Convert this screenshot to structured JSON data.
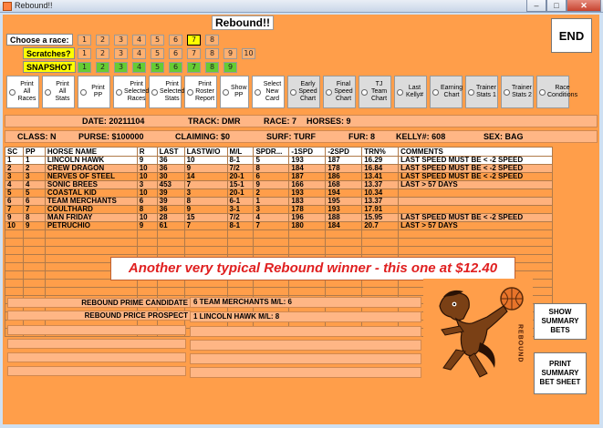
{
  "window": {
    "title": "Rebound!!",
    "min": "–",
    "max": "□",
    "close": "✕"
  },
  "app": {
    "title": "Rebound!!",
    "end_label": "END"
  },
  "race_selector": {
    "choose_label": "Choose a race:",
    "scratches_label": "Scratches?",
    "snapshot_label": "SNAPSHOT",
    "race_numbers": [
      "1",
      "2",
      "3",
      "4",
      "5",
      "6",
      "7",
      "8"
    ],
    "selected_race": "7",
    "scratch_numbers": [
      "1",
      "2",
      "3",
      "4",
      "5",
      "6",
      "7",
      "8",
      "9",
      "10"
    ],
    "snapshot_numbers": [
      "1",
      "2",
      "3",
      "4",
      "5",
      "6",
      "7",
      "8",
      "9"
    ]
  },
  "options": [
    {
      "label": "Print All Races",
      "style": "white"
    },
    {
      "label": "Print All Stats",
      "style": "white"
    },
    {
      "label": "Print PP",
      "style": "white"
    },
    {
      "label": "Print Selected Races",
      "style": "white"
    },
    {
      "label": "Print Selected Stats",
      "style": "white"
    },
    {
      "label": "Print Roster Report",
      "style": "white"
    },
    {
      "label": "Show PP",
      "style": "white"
    },
    {
      "label": "Select New Card",
      "style": "white"
    },
    {
      "label": "Early Speed Chart",
      "style": "gray"
    },
    {
      "label": "Final Speed Chart",
      "style": "gray"
    },
    {
      "label": "TJ Team Chart",
      "style": "gray"
    },
    {
      "label": "Last Kelly#",
      "style": "gray"
    },
    {
      "label": "Earning Chart",
      "style": "gray"
    },
    {
      "label": "Trainer Stats 1",
      "style": "gray"
    },
    {
      "label": "Trainer Stats 2",
      "style": "gray"
    },
    {
      "label": "Race Conditions",
      "style": "gray"
    }
  ],
  "race_info": {
    "date": "DATE: 20211104",
    "track": "TRACK: DMR",
    "race": "RACE: 7",
    "horses": "HORSES: 9",
    "class": "CLASS: N",
    "purse": "PURSE: $100000",
    "claiming": "CLAIMING: $0",
    "surf": "SURF: TURF",
    "fur": "FUR: 8",
    "kelly": "KELLY#: 608",
    "sex": "SEX: BAG"
  },
  "table": {
    "headers": [
      "SC",
      "PP",
      "HORSE NAME",
      "R",
      "LAST",
      "LASTW/O",
      "M/L",
      "SPDR...",
      "-1SPD",
      "-2SPD",
      "TRN%",
      "COMMENTS"
    ],
    "rows": [
      [
        "1",
        "1",
        "LINCOLN HAWK",
        "9",
        "36",
        "10",
        "8-1",
        "5",
        "193",
        "187",
        "16.29",
        "LAST SPEED MUST BE < -2 SPEED"
      ],
      [
        "2",
        "2",
        "CREW DRAGON",
        "10",
        "36",
        "9",
        "7/2",
        "8",
        "184",
        "178",
        "16.84",
        "LAST SPEED MUST BE < -2 SPEED"
      ],
      [
        "3",
        "3",
        "NERVES OF STEEL",
        "10",
        "30",
        "14",
        "20-1",
        "6",
        "187",
        "186",
        "13.41",
        "LAST SPEED MUST BE < -2 SPEED"
      ],
      [
        "4",
        "4",
        "SONIC BREES",
        "3",
        "453",
        "7",
        "15-1",
        "9",
        "166",
        "168",
        "13.37",
        "LAST > 57 DAYS"
      ],
      [
        "5",
        "5",
        "COASTAL KID",
        "10",
        "39",
        "3",
        "20-1",
        "2",
        "193",
        "194",
        "10.34",
        ""
      ],
      [
        "6",
        "6",
        "TEAM MERCHANTS",
        "6",
        "39",
        "8",
        "6-1",
        "1",
        "183",
        "195",
        "13.37",
        ""
      ],
      [
        "7",
        "7",
        "COULTHARD",
        "8",
        "36",
        "9",
        "3-1",
        "3",
        "178",
        "193",
        "17.91",
        ""
      ],
      [
        "9",
        "8",
        "MAN FRIDAY",
        "10",
        "28",
        "15",
        "7/2",
        "4",
        "196",
        "188",
        "15.95",
        "LAST SPEED MUST BE < -2 SPEED"
      ],
      [
        "10",
        "9",
        "PETRUCHIO",
        "9",
        "61",
        "7",
        "8-1",
        "7",
        "180",
        "184",
        "20.7",
        "LAST > 57 DAYS"
      ]
    ],
    "highlight_row": 0
  },
  "banner": "Another very typical Rebound winner - this one at $12.40",
  "lower": {
    "prime_label": "REBOUND PRIME CANDIDATE",
    "prime_value": "6  TEAM MERCHANTS  M/L: 6",
    "price_label": "REBOUND PRICE PROSPECT",
    "price_value": "1  LINCOLN HAWK  M/L: 8",
    "logo_text": "REBOUND",
    "show_summary": "SHOW SUMMARY BETS",
    "print_summary": "PRINT SUMMARY BET SHEET"
  },
  "colors": {
    "background": "#ff9e4a",
    "row_alt": "#ffb27d",
    "banner_text": "#e02020",
    "snapshot_green": "#66cc33",
    "highlight_yellow": "#ffff00"
  }
}
